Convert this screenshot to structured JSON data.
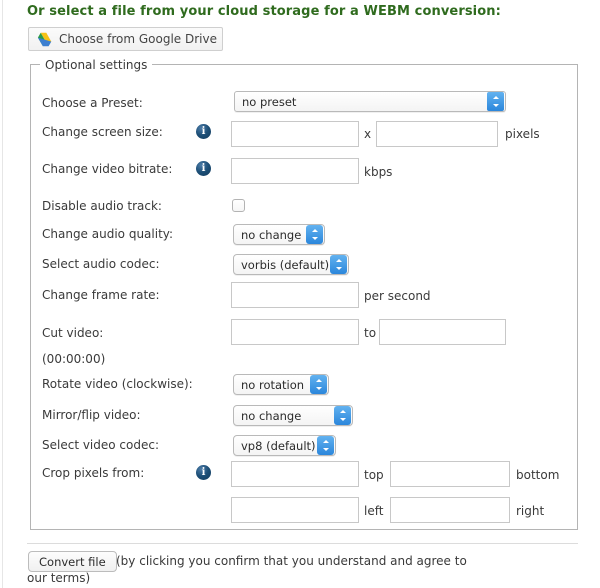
{
  "heading": "Or select a file from your cloud storage for a WEBM conversion:",
  "gdrive_button": {
    "label": "Choose from Google Drive",
    "icon": "google-drive-icon"
  },
  "fieldset": {
    "legend": "Optional settings"
  },
  "rows": {
    "preset": {
      "label": "Choose a Preset:",
      "select_value": "no preset"
    },
    "screen_size": {
      "label": "Change screen size:",
      "info": "info-icon",
      "width_value": "",
      "separator": "x",
      "height_value": "",
      "suffix": "pixels"
    },
    "video_bitrate": {
      "label": "Change video bitrate:",
      "info": "info-icon",
      "value": "",
      "suffix": "kbps"
    },
    "disable_audio": {
      "label": "Disable audio track:",
      "checked": false
    },
    "audio_quality": {
      "label": "Change audio quality:",
      "select_value": "no change"
    },
    "audio_codec": {
      "label": "Select audio codec:",
      "select_value": "vorbis (default)"
    },
    "frame_rate": {
      "label": "Change frame rate:",
      "value": "",
      "suffix": "per second"
    },
    "cut_video": {
      "label": "Cut video:",
      "from_value": "",
      "separator": "to",
      "to_value": "",
      "hint": "(00:00:00)"
    },
    "rotate": {
      "label": "Rotate video (clockwise):",
      "select_value": "no rotation"
    },
    "mirror": {
      "label": "Mirror/flip video:",
      "select_value": "no change"
    },
    "video_codec": {
      "label": "Select video codec:",
      "select_value": "vp8 (default)"
    },
    "crop": {
      "label": "Crop pixels from:",
      "info": "info-icon",
      "top_value": "",
      "top_suffix": "top",
      "bottom_value": "",
      "bottom_suffix": "bottom",
      "left_value": "",
      "left_suffix": "left",
      "right_value": "",
      "right_suffix": "right"
    }
  },
  "footer": {
    "convert_label": "Convert file",
    "disclaimer_part1": "(by clicking you confirm that you understand and agree to",
    "disclaimer_part2": "our ",
    "terms_link": "terms",
    "disclaimer_part3": ")"
  },
  "colors": {
    "heading_green": "#2f6b1e",
    "link_green": "#2f6b1e",
    "select_blue": "#2b86db",
    "info_navy": "#1d4f77"
  }
}
